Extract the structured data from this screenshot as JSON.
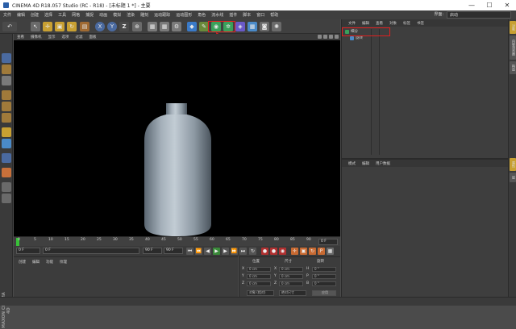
{
  "window": {
    "title": "CINEMA 4D R18.057 Studio (RC - R18) - [未标题 1 *] - 主要",
    "min": "—",
    "max": "☐",
    "close": "✕"
  },
  "menu": {
    "items": [
      "文件",
      "编辑",
      "创建",
      "选择",
      "工具",
      "网格",
      "捕捉",
      "动画",
      "模拟",
      "渲染",
      "雕刻",
      "运动跟踪",
      "运动图形",
      "角色",
      "流水线",
      "插件",
      "脚本",
      "窗口",
      "帮助"
    ],
    "layout_label": "界面:",
    "layout_value": "启动"
  },
  "toolbar": {
    "undo": "↶",
    "x": "X",
    "y": "Y",
    "z": "Z"
  },
  "viewport": {
    "menu": [
      "查看",
      "摄像机",
      "显示",
      "选项",
      "过滤",
      "面板"
    ]
  },
  "timeline": {
    "ticks": [
      "0",
      "5",
      "10",
      "15",
      "20",
      "25",
      "30",
      "35",
      "40",
      "45",
      "50",
      "55",
      "60",
      "65",
      "70",
      "75",
      "80",
      "85",
      "90"
    ],
    "end_label": "0 F"
  },
  "transport": {
    "start_frame": "0 F",
    "current_frame": "0 F",
    "end_frame": "90 F",
    "max_frame": "90 F"
  },
  "materials": {
    "menu": [
      "创建",
      "编辑",
      "功能",
      "纹理"
    ]
  },
  "coords": {
    "header": [
      "位置",
      "尺寸",
      "旋转"
    ],
    "rows": [
      {
        "axis": "X",
        "pos": "0 cm",
        "size": "0 cm",
        "rot_label": "H",
        "rot": "0 °"
      },
      {
        "axis": "Y",
        "pos": "0 cm",
        "size": "0 cm",
        "rot_label": "P",
        "rot": "0 °"
      },
      {
        "axis": "Z",
        "pos": "0 cm",
        "size": "0 cm",
        "rot_label": "B",
        "rot": "0 °"
      }
    ],
    "mode_left": "对象 (相对)",
    "mode_mid": "绝对尺寸",
    "apply": "应用"
  },
  "objects": {
    "menu": [
      "文件",
      "编辑",
      "查看",
      "对象",
      "标签",
      "书签"
    ],
    "items": [
      {
        "name": "细分",
        "icon": "subdivision-icon"
      },
      {
        "name": "旋转",
        "icon": "lathe-icon"
      }
    ]
  },
  "attributes": {
    "menu": [
      "模式",
      "编辑",
      "用户数据"
    ]
  },
  "right_tabs": [
    "对象",
    "内容浏览器",
    "构造",
    "属性",
    "层"
  ],
  "logo": "MAXON CINEMA 4D",
  "accent": "#e12020"
}
